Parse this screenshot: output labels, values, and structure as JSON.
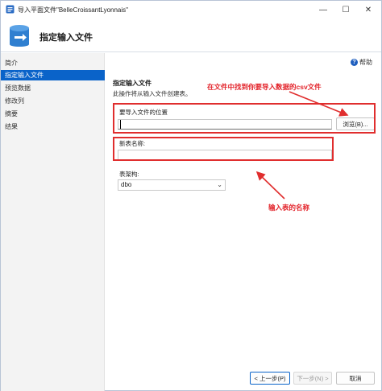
{
  "window": {
    "title": "导入平面文件\"BelleCroissantLyonnais\"",
    "min_glyph": "—",
    "max_glyph": "☐",
    "close_glyph": "✕"
  },
  "header": {
    "title": "指定输入文件"
  },
  "sidebar": {
    "items": [
      {
        "label": "简介",
        "active": false
      },
      {
        "label": "指定输入文件",
        "active": true
      },
      {
        "label": "预览数据",
        "active": false
      },
      {
        "label": "修改列",
        "active": false
      },
      {
        "label": "摘要",
        "active": false
      },
      {
        "label": "结果",
        "active": false
      }
    ]
  },
  "help": {
    "label": "帮助",
    "glyph": "?"
  },
  "main": {
    "section_title": "指定输入文件",
    "section_desc": "此操作将从输入文件创建表。",
    "file_location_label": "要导入文件的位置",
    "file_location_value": "",
    "browse_label": "浏览(B)...",
    "new_table_label": "新表名称:",
    "new_table_value": "",
    "schema_label": "表架构:",
    "schema_value": "dbo"
  },
  "annotations": {
    "top_note": "在文件中找到你要导入数据的csv文件",
    "bottom_note": "输入表的名称",
    "color": "#e3242b"
  },
  "footer": {
    "prev_label": "< 上一步(P)",
    "next_label": "下一步(N) >",
    "cancel_label": "取消"
  },
  "colors": {
    "accent": "#0a63c9",
    "annotation_red": "#e02e2e"
  }
}
